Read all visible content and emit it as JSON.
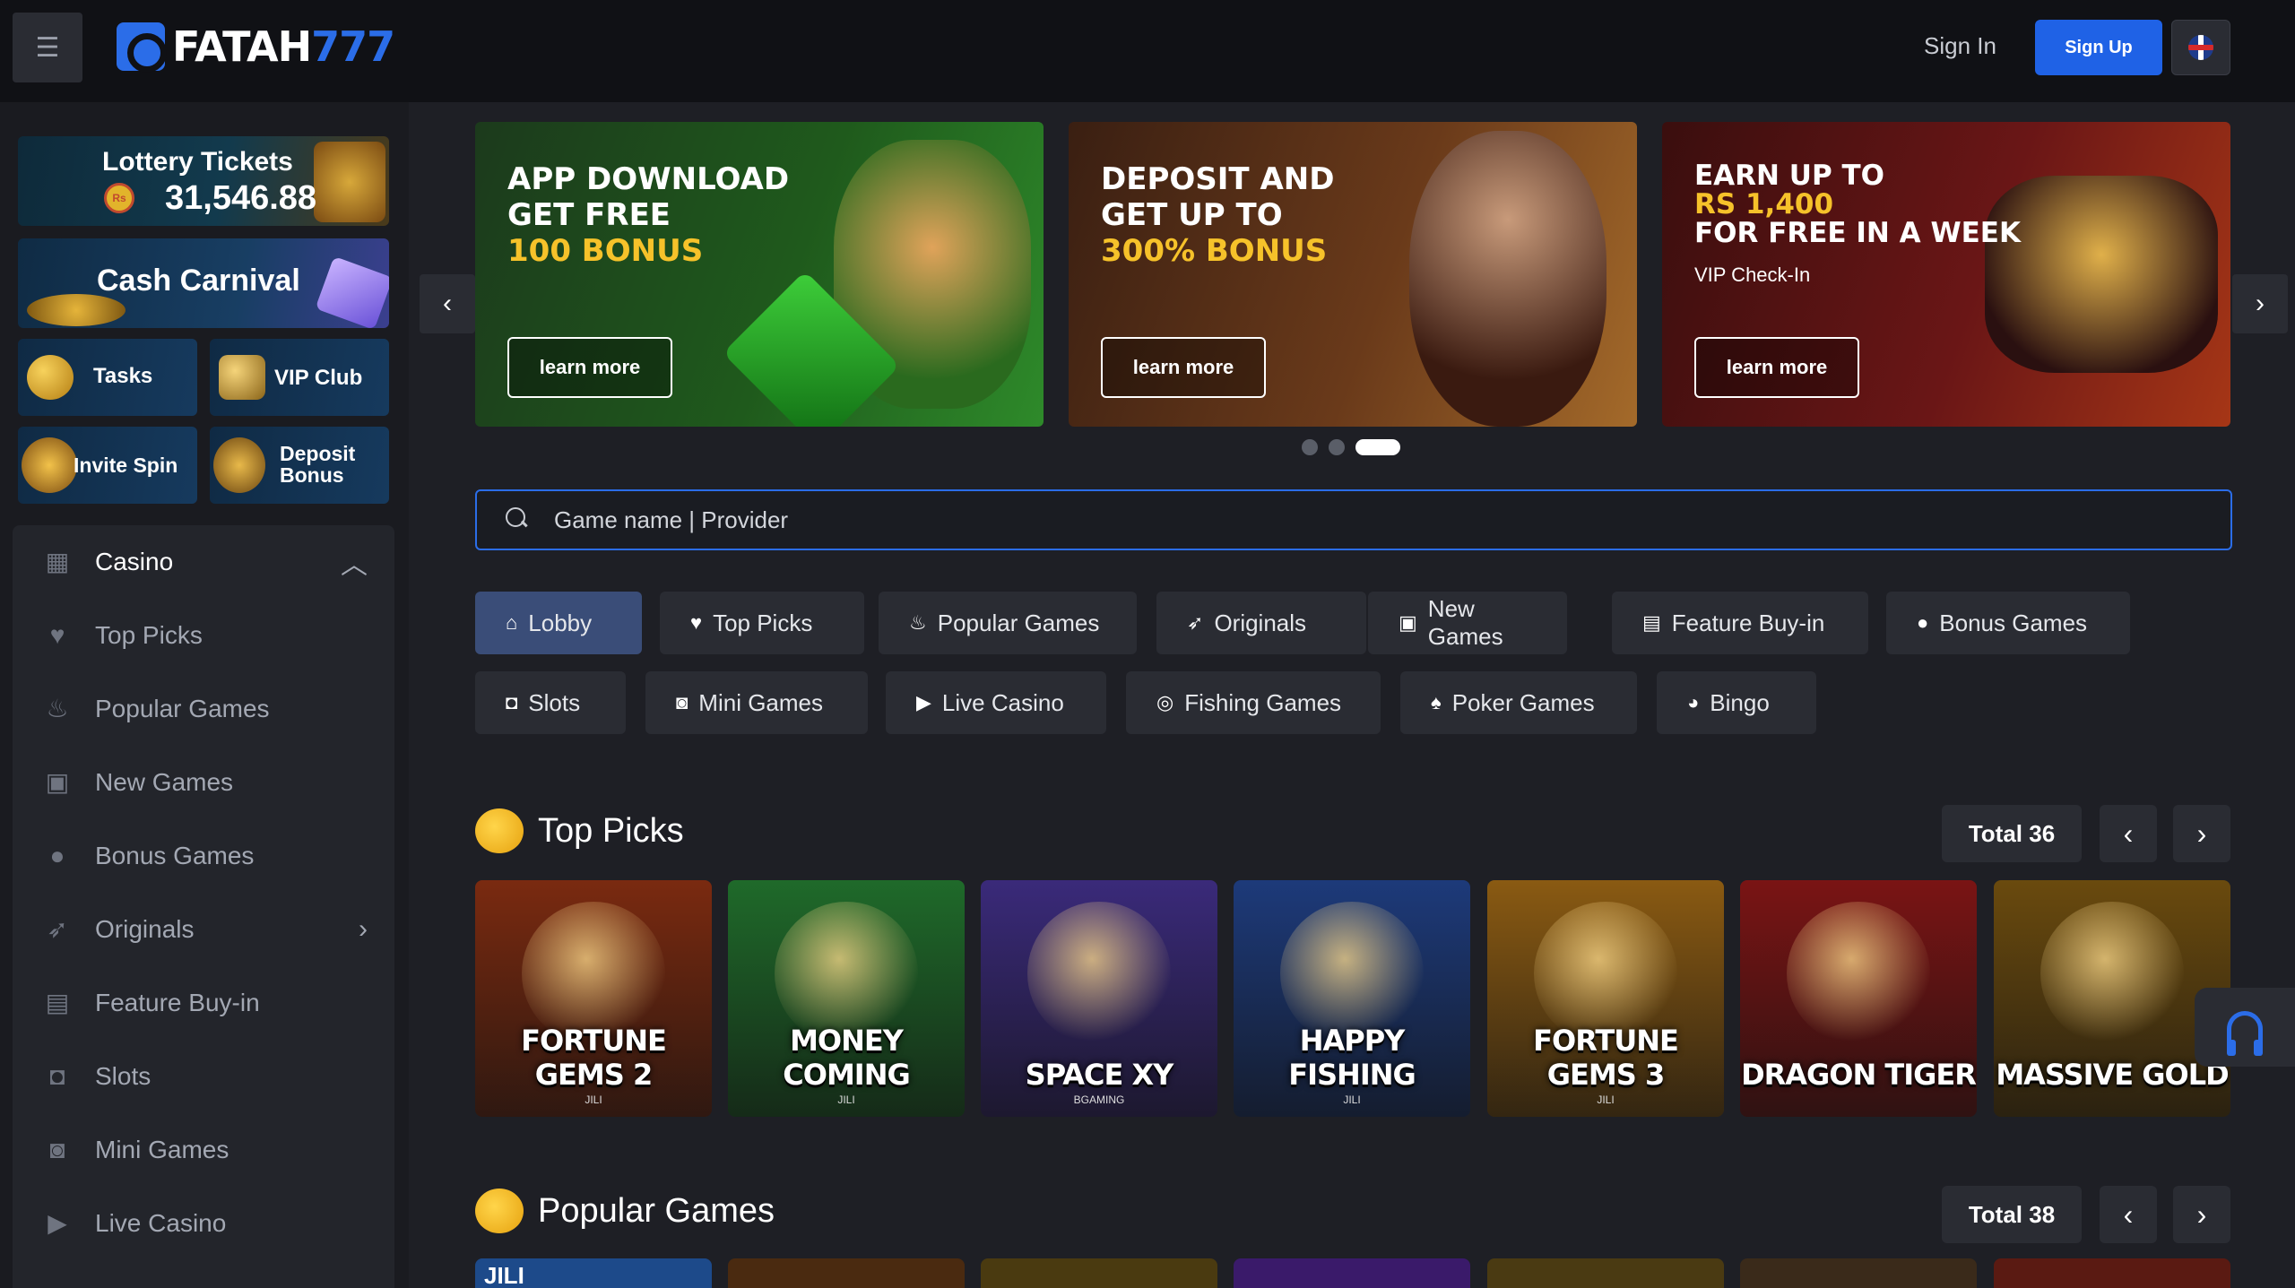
{
  "header": {
    "logo_text_a": "FATAH",
    "logo_text_b": "777",
    "sign_in": "Sign In",
    "sign_up": "Sign Up"
  },
  "sidebar": {
    "promos": {
      "lottery_title": "Lottery Tickets",
      "lottery_amount": "31,546.88",
      "lottery_currency": "Rs",
      "cash_carnival": "Cash Carnival",
      "tasks": "Tasks",
      "vip_club": "VIP Club",
      "invite_spin": "Invite Spin",
      "deposit_bonus_1": "Deposit",
      "deposit_bonus_2": "Bonus"
    },
    "menu": [
      {
        "label": "Casino",
        "icon": "casino-icon"
      },
      {
        "label": "Top Picks",
        "icon": "heart-pulse-icon"
      },
      {
        "label": "Popular Games",
        "icon": "fire-icon"
      },
      {
        "label": "New Games",
        "icon": "gift-icon"
      },
      {
        "label": "Bonus Games",
        "icon": "bonus-coin-icon"
      },
      {
        "label": "Originals",
        "icon": "rocket-icon"
      },
      {
        "label": "Feature Buy-in",
        "icon": "cart-icon"
      },
      {
        "label": "Slots",
        "icon": "slots-icon"
      },
      {
        "label": "Mini Games",
        "icon": "gamepad-icon"
      },
      {
        "label": "Live Casino",
        "icon": "video-icon"
      }
    ]
  },
  "banners": [
    {
      "line1": "APP DOWNLOAD",
      "line2": "GET FREE",
      "line3": "100 BONUS",
      "sub": "",
      "button": "learn more"
    },
    {
      "line1": "DEPOSIT AND",
      "line2": "GET UP TO",
      "line3": "300% BONUS",
      "sub": "",
      "button": "learn more"
    },
    {
      "line1": "EARN UP TO",
      "line2": "RS 1,400",
      "line3": "FOR FREE IN A WEEK",
      "sub": "VIP Check-In",
      "button": "learn more"
    }
  ],
  "search": {
    "placeholder": "Game name | Provider"
  },
  "categories": [
    {
      "label": "Lobby",
      "icon": "home-icon"
    },
    {
      "label": "Top Picks",
      "icon": "heart-pulse-icon"
    },
    {
      "label": "Popular Games",
      "icon": "fire-icon"
    },
    {
      "label": "Originals",
      "icon": "rocket-icon"
    },
    {
      "label": "New Games",
      "icon": "gift-icon"
    },
    {
      "label": "Feature Buy-in",
      "icon": "cart-icon"
    },
    {
      "label": "Bonus Games",
      "icon": "bonus-coin-icon"
    },
    {
      "label": "Slots",
      "icon": "slots-icon"
    },
    {
      "label": "Mini Games",
      "icon": "gamepad-icon"
    },
    {
      "label": "Live Casino",
      "icon": "video-icon"
    },
    {
      "label": "Fishing Games",
      "icon": "fishing-icon"
    },
    {
      "label": "Poker Games",
      "icon": "spade-icon"
    },
    {
      "label": "Bingo",
      "icon": "bingo-icon"
    }
  ],
  "top_picks": {
    "title": "Top Picks",
    "total": "Total 36",
    "games": [
      {
        "title": "FORTUNE GEMS 2",
        "provider": "JILI",
        "color": "#7a2a10"
      },
      {
        "title": "MONEY COMING",
        "provider": "JILI",
        "color": "#1f6a2a"
      },
      {
        "title": "SPACE XY",
        "provider": "BGAMING",
        "color": "#3a2a7a"
      },
      {
        "title": "HAPPY FISHING",
        "provider": "JILI",
        "color": "#1d3a7a"
      },
      {
        "title": "FORTUNE GEMS 3",
        "provider": "JILI",
        "color": "#8a5a12"
      },
      {
        "title": "DRAGON TIGER",
        "provider": "",
        "color": "#7a1414"
      },
      {
        "title": "MASSIVE GOLD",
        "provider": "",
        "color": "#6a4a0e"
      }
    ]
  },
  "popular_games": {
    "title": "Popular Games",
    "total": "Total 38",
    "tile_colors": [
      "#1d4a8a",
      "#4a2a10",
      "#4a3a10",
      "#3a1a6a",
      "#4a3a12",
      "#3a2a1a",
      "#5a1a12"
    ],
    "first_tile_label": "JILI"
  }
}
